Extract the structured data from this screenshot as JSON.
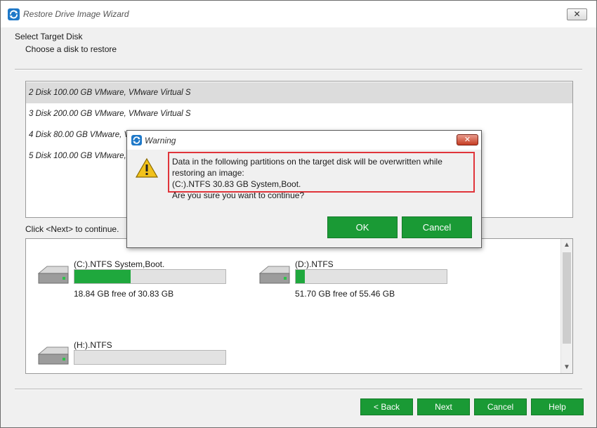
{
  "window": {
    "title": "Restore Drive Image Wizard",
    "close_glyph": "✕"
  },
  "header": {
    "title": "Select Target Disk",
    "subtitle": "Choose a disk to restore"
  },
  "disk_list": {
    "items": [
      {
        "label": "2 Disk 100.00 GB VMware,  VMware Virtual S",
        "selected": true
      },
      {
        "label": "3 Disk 200.00 GB VMware,  VMware Virtual S",
        "selected": false
      },
      {
        "label": "4 Disk 80.00 GB VMware,  V",
        "selected": false
      },
      {
        "label": "5 Disk 100.00 GB VMware,",
        "selected": false
      }
    ]
  },
  "hint": "Click <Next> to continue.",
  "partitions": [
    {
      "label": "(C:).NTFS System,Boot.",
      "free_text": "18.84 GB free of 30.83 GB",
      "used_fraction": 0.37
    },
    {
      "label": "(D:).NTFS",
      "free_text": "51.70 GB free of 55.46 GB",
      "used_fraction": 0.06
    },
    {
      "label": "(H:).NTFS",
      "free_text": "",
      "used_fraction": 0.0
    }
  ],
  "footer": {
    "back_label": "< Back",
    "next_label": "Next",
    "cancel_label": "Cancel",
    "help_label": "Help"
  },
  "dialog": {
    "title": "Warning",
    "close_glyph": "✕",
    "message_line1": "Data in the following partitions on the target disk will be overwritten while",
    "message_line2": "restoring an image:",
    "message_line3": "(C:).NTFS 30.83 GB System,Boot.",
    "question": "Are you sure you want to continue?",
    "ok_label": "OK",
    "cancel_label": "Cancel"
  },
  "icons": {
    "app": "app-restore-icon",
    "warning": "warning-triangle-icon",
    "drive": "hard-drive-icon",
    "scroll_up": "scroll-up-arrow-icon",
    "scroll_down": "scroll-down-arrow-icon"
  },
  "colors": {
    "accent_green": "#1a9a35",
    "usage_fill": "#1fa83d",
    "highlight_red": "#e0343a",
    "selected_row": "#dcdcdc"
  }
}
